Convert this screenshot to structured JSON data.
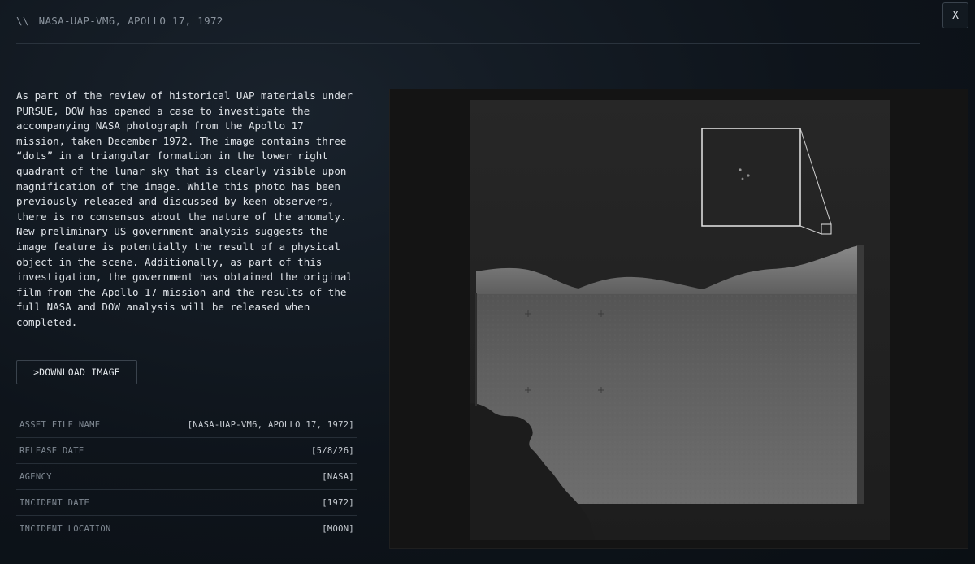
{
  "header": {
    "prefix": "\\\\",
    "title": "NASA-UAP-VM6, APOLLO 17, 1972",
    "close_label": "X"
  },
  "description": "As part of the review of historical UAP materials under PURSUE, DOW has opened a case to investigate the accompanying NASA photograph from the Apollo 17 mission, taken December 1972. The image contains three “dots” in a triangular formation in the lower right quadrant of the lunar sky that is clearly visible upon magnification of the image. While this photo has been previously released and discussed by keen observers, there is no consensus about the nature of the anomaly. New preliminary US government analysis suggests the image feature is potentially the result of a physical object in the scene. Additionally, as part of this investigation, the government has obtained the original film from the Apollo 17 mission and the results of the full NASA and DOW analysis will be released when completed.",
  "download_label": ">DOWNLOAD IMAGE",
  "metadata": [
    {
      "label": "ASSET FILE NAME",
      "value": "[NASA-UAP-VM6, APOLLO 17, 1972]"
    },
    {
      "label": "RELEASE DATE",
      "value": "[5/8/26]"
    },
    {
      "label": "AGENCY",
      "value": "[NASA]"
    },
    {
      "label": "INCIDENT DATE",
      "value": "[1972]"
    },
    {
      "label": "INCIDENT LOCATION",
      "value": "[MOON]"
    }
  ],
  "colors": {
    "background": "#0d1218",
    "text": "#dfe3e8",
    "muted": "#7f8892",
    "border": "#3a434d"
  }
}
